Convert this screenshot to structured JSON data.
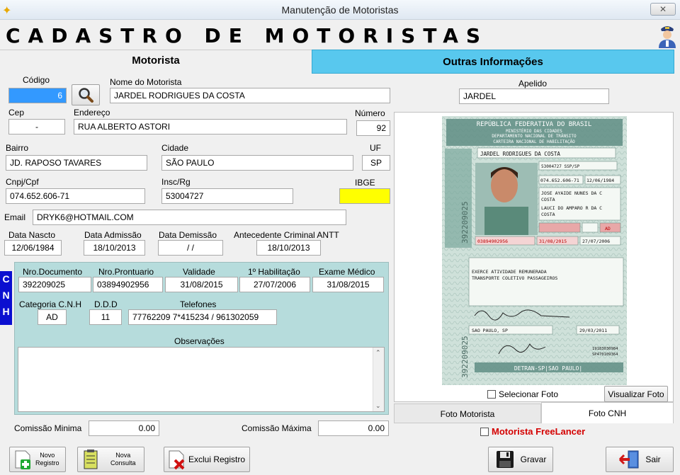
{
  "window": {
    "title": "Manutenção de Motoristas",
    "close_label": "✕"
  },
  "header": {
    "title": "CADASTRO DE MOTORISTAS"
  },
  "tabs": {
    "motorista": "Motorista",
    "outras": "Outras Informações"
  },
  "labels": {
    "codigo": "Código",
    "nome": "Nome do Motorista",
    "apelido": "Apelido",
    "cep": "Cep",
    "endereco": "Endereço",
    "numero": "Número",
    "bairro": "Bairro",
    "cidade": "Cidade",
    "uf": "UF",
    "cnpj": "Cnpj/Cpf",
    "insc": "Insc/Rg",
    "ibge": "IBGE",
    "email": "Email",
    "data_nascto": "Data Nascto",
    "data_admissao": "Data Admissão",
    "data_demissao": "Data Demissão",
    "antecedente": "Antecedente Criminal ANTT",
    "nro_documento": "Nro.Documento",
    "nro_prontuario": "Nro.Prontuario",
    "validade": "Validade",
    "primeira_hab": "1º Habilitação",
    "exame_medico": "Exame Médico",
    "categoria": "Categoria C.N.H",
    "ddd": "D.D.D",
    "telefones": "Telefones",
    "observacoes": "Observações",
    "comissao_minima": "Comissão Minima",
    "comissao_maxima": "Comissão Máxima"
  },
  "values": {
    "codigo": "6",
    "nome": "JARDEL RODRIGUES DA COSTA",
    "apelido": "JARDEL",
    "cep": "-",
    "endereco": "RUA ALBERTO ASTORI",
    "numero": "92",
    "bairro": "JD. RAPOSO TAVARES",
    "cidade": "SÃO PAULO",
    "uf": "SP",
    "cnpj": "074.652.606-71",
    "insc": "53004727",
    "ibge": "",
    "email": "DRYK6@HOTMAIL.COM",
    "data_nascto": "12/06/1984",
    "data_admissao": "18/10/2013",
    "data_demissao": "/ /",
    "antecedente": "18/10/2013",
    "nro_documento": "392209025",
    "nro_prontuario": "03894902956",
    "validade": "31/08/2015",
    "primeira_hab": "27/07/2006",
    "exame_medico": "31/08/2015",
    "categoria": "AD",
    "ddd": "11",
    "telefones": "77762209 7*415234 / 961302059",
    "observacoes": "",
    "comissao_minima": "0.00",
    "comissao_maxima": "0.00"
  },
  "cnh_strip": [
    "C",
    "N",
    "H"
  ],
  "photo": {
    "selecionar": "Selecionar Foto",
    "visualizar": "Visualizar Foto",
    "tab_motorista": "Foto Motorista",
    "tab_cnh": "Foto CNH",
    "freelancer": "Motorista FreeLancer",
    "card": {
      "header1": "REPÚBLICA FEDERATIVA DO BRASIL",
      "header2": "MINISTÉRIO DAS CIDADES",
      "header3": "DEPARTAMENTO NACIONAL DE TRÂNSITO",
      "header4": "CARTEIRA NACIONAL DE HABILITAÇÃO",
      "name": "JARDEL RODRIGUES DA COSTA",
      "doc": "53004727 SSP/SP",
      "cpf": "074.652.606-71",
      "birth": "12/06/1984",
      "filiacao1": "JOSE AYAIDE NUNES DA C",
      "filiacao2": "COSTA",
      "filiacao3": "LAUCI DO AMPARO R DA C",
      "filiacao4": "COSTA",
      "cat": "AD",
      "registro": "03894902956",
      "validade": "31/08/2015",
      "primeira": "27/07/2006",
      "obs1": "EXERCE ATIVIDADE REMUNERADA",
      "obs2": "TRANSPORTE COLETIVO PASSAGEIROS",
      "local": "SAO PAULO, SP",
      "emissao": "29/03/2011",
      "code1": "19183030984",
      "code2": "SP470109364",
      "side_number": "392209025",
      "footer": "DETRAN-SP|SAO PAULO|"
    }
  },
  "buttons": {
    "novo_registro": [
      "Novo",
      "Registro"
    ],
    "nova_consulta": [
      "Nova",
      "Consulta"
    ],
    "exclui": "Exclui Registro",
    "gravar": "Gravar",
    "sair": "Sair"
  },
  "colors": {
    "accent_tab": "#58c8ee",
    "cnh_panel": "#b6dcdc",
    "cnh_strip": "#0b0fd0",
    "ibge_bg": "#ffff00",
    "freelancer": "#d40000",
    "selected_code": "#3399ff"
  }
}
